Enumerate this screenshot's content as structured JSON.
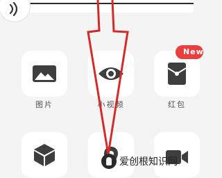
{
  "grid": {
    "row1": [
      {
        "label": "图片",
        "icon": "image-icon"
      },
      {
        "label": "小视频",
        "icon": "eye-icon"
      },
      {
        "label": "红包",
        "icon": "red-envelope-icon",
        "badge": "New"
      }
    ],
    "row2": [
      {
        "label": "",
        "icon": "cube-icon"
      },
      {
        "label": "",
        "icon": "location-icon"
      },
      {
        "label": "",
        "icon": "video-camera-icon"
      }
    ]
  },
  "watermark": {
    "text": "爱创根知识网"
  },
  "colors": {
    "badge": "#e93f3f",
    "annotation_arrow": "#d42a2a",
    "icon": "#454545"
  }
}
